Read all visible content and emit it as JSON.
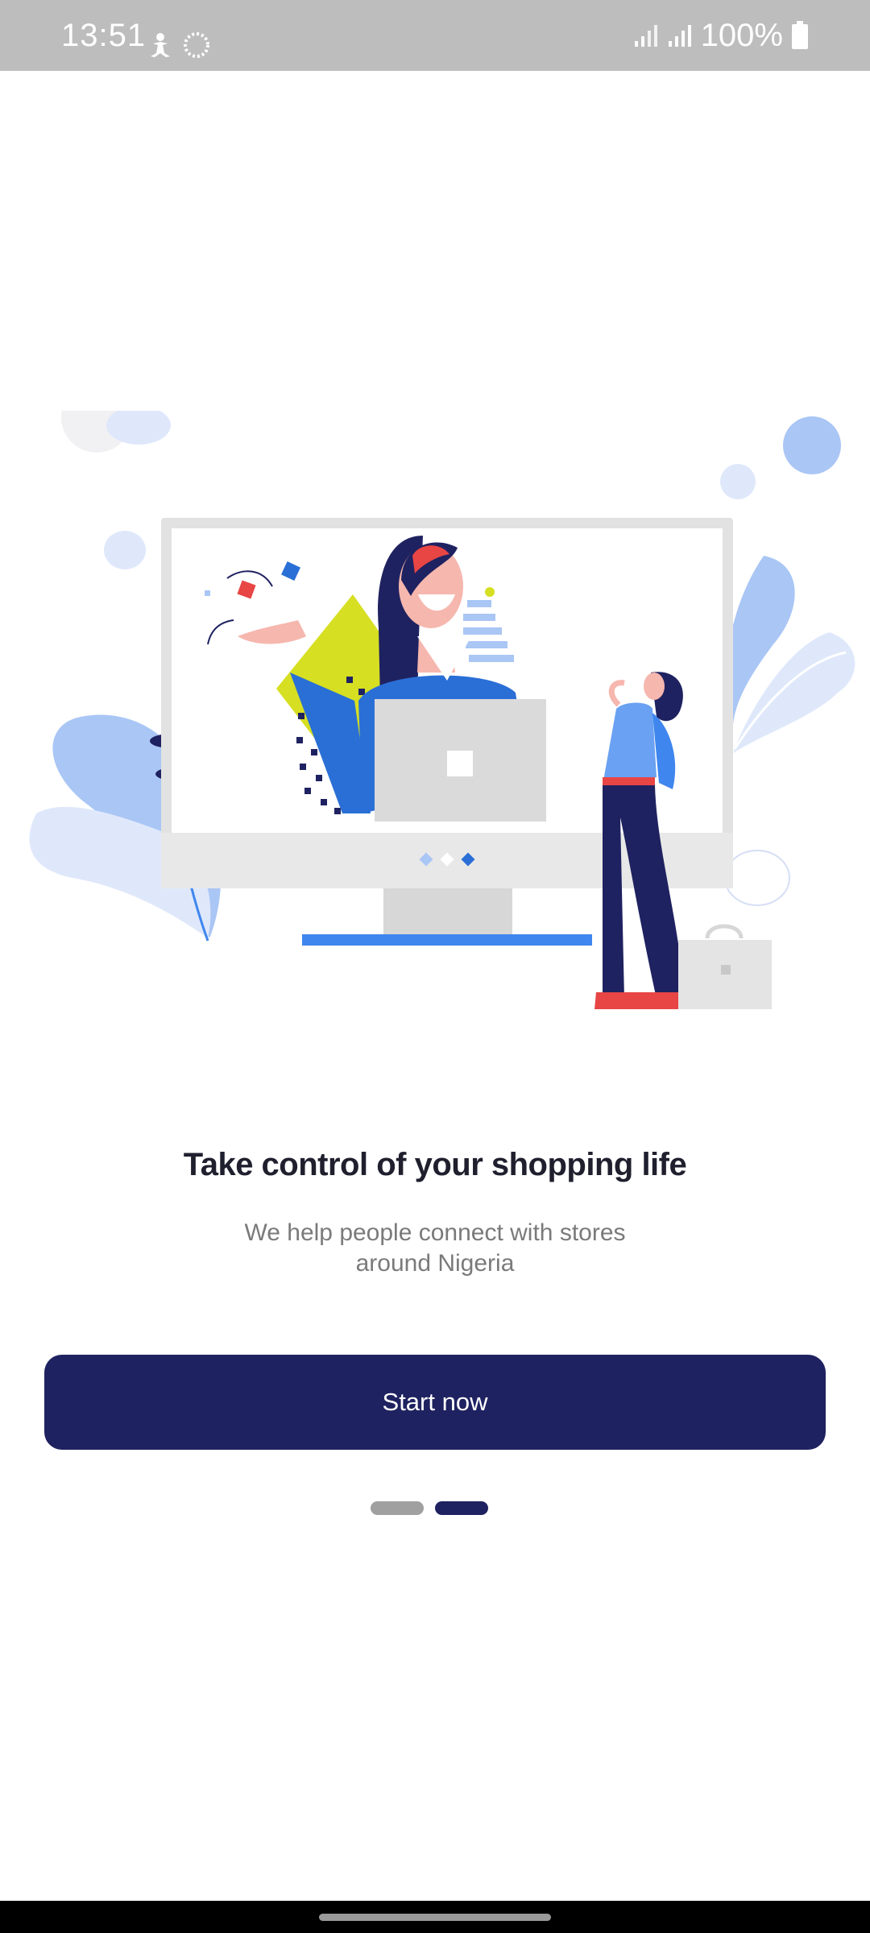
{
  "status_bar": {
    "time": "13:51",
    "battery": "100%",
    "icons": [
      "accessibility-icon",
      "loading-ring-icon",
      "signal-icon",
      "signal-icon",
      "battery-icon"
    ]
  },
  "onboarding": {
    "title": "Take control of your shopping life",
    "subtitle_line1": "We help people connect with stores",
    "subtitle_line2": "around Nigeria",
    "start_button_label": "Start now",
    "pager": {
      "total": 2,
      "current": 2
    }
  },
  "colors": {
    "primary": "#1f2260",
    "accent_blue": "#3f86ee",
    "light_blue": "#a9c6f5",
    "pager_inactive": "#a0a0a0",
    "status_bar": "#bdbdbd"
  }
}
